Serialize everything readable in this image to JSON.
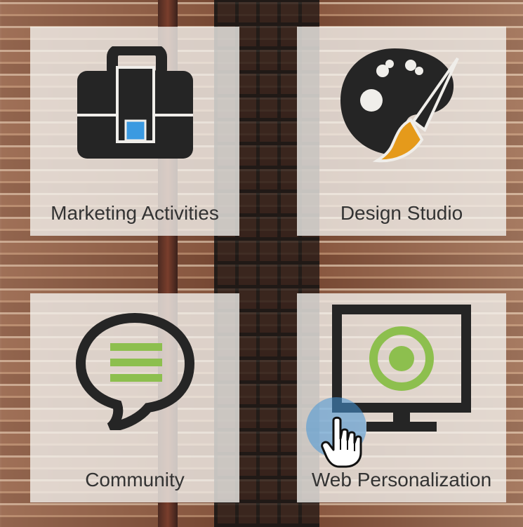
{
  "tiles": [
    {
      "label": "Marketing Activities",
      "icon": "briefcase-icon"
    },
    {
      "label": "Design Studio",
      "icon": "palette-icon"
    },
    {
      "label": "Community",
      "icon": "chat-bubble-icon"
    },
    {
      "label": "Web Personalization",
      "icon": "monitor-target-icon"
    }
  ],
  "cursor": {
    "icon": "hand-pointer-icon"
  },
  "colors": {
    "icon_dark": "#252525",
    "accent_blue": "#3b9ae1",
    "accent_orange": "#e59a1b",
    "accent_green": "#8dbf4e"
  }
}
